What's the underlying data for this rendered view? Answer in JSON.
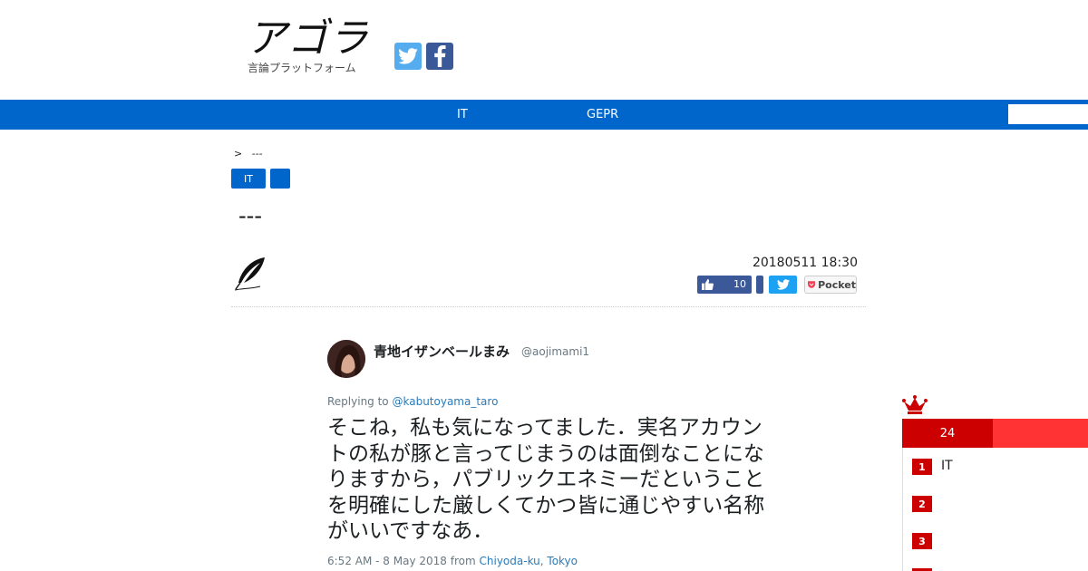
{
  "header": {
    "logo_text": "アゴラ",
    "logo_subtitle": "言論プラットフォーム",
    "social": [
      "twitter-icon",
      "facebook-icon"
    ]
  },
  "nav": {
    "items": [
      "IT",
      "GEPR"
    ],
    "search_placeholder": ""
  },
  "breadcrumb": {
    "separator": ">",
    "current": "---"
  },
  "tags": [
    "IT",
    ""
  ],
  "article": {
    "title": "---",
    "date": "20180511 18:30",
    "like_count": "10",
    "pocket_label": "Pocket"
  },
  "tweet": {
    "name": "青地イザンベールまみ",
    "handle": "@aojimami1",
    "reply_prefix": "Replying to",
    "reply_to": "@kabutoyama_taro",
    "text": "そこね，私も気になってました．実名アカウントの私が豚と言ってじまうのは面倒なことになりますから，パブリックエネミーだということを明確にした厳しくてかつ皆に通じやすい名称がいいですなあ．",
    "time": "6:52 AM - 8 May 2018",
    "from_label": "from",
    "location_city": "Chiyoda-ku",
    "location_sep": ",",
    "location_pref": "Tokyo"
  },
  "ranking": {
    "tab_label": "24",
    "items": [
      {
        "rank": "1",
        "label": "IT"
      },
      {
        "rank": "2",
        "label": ""
      },
      {
        "rank": "3",
        "label": ""
      }
    ]
  },
  "colors": {
    "nav_blue": "#0066cc",
    "ranking_red": "#cc0000",
    "ranking_red_light": "#ff3333",
    "twitter_blue": "#1da1f2",
    "facebook_blue": "#3b5998"
  }
}
